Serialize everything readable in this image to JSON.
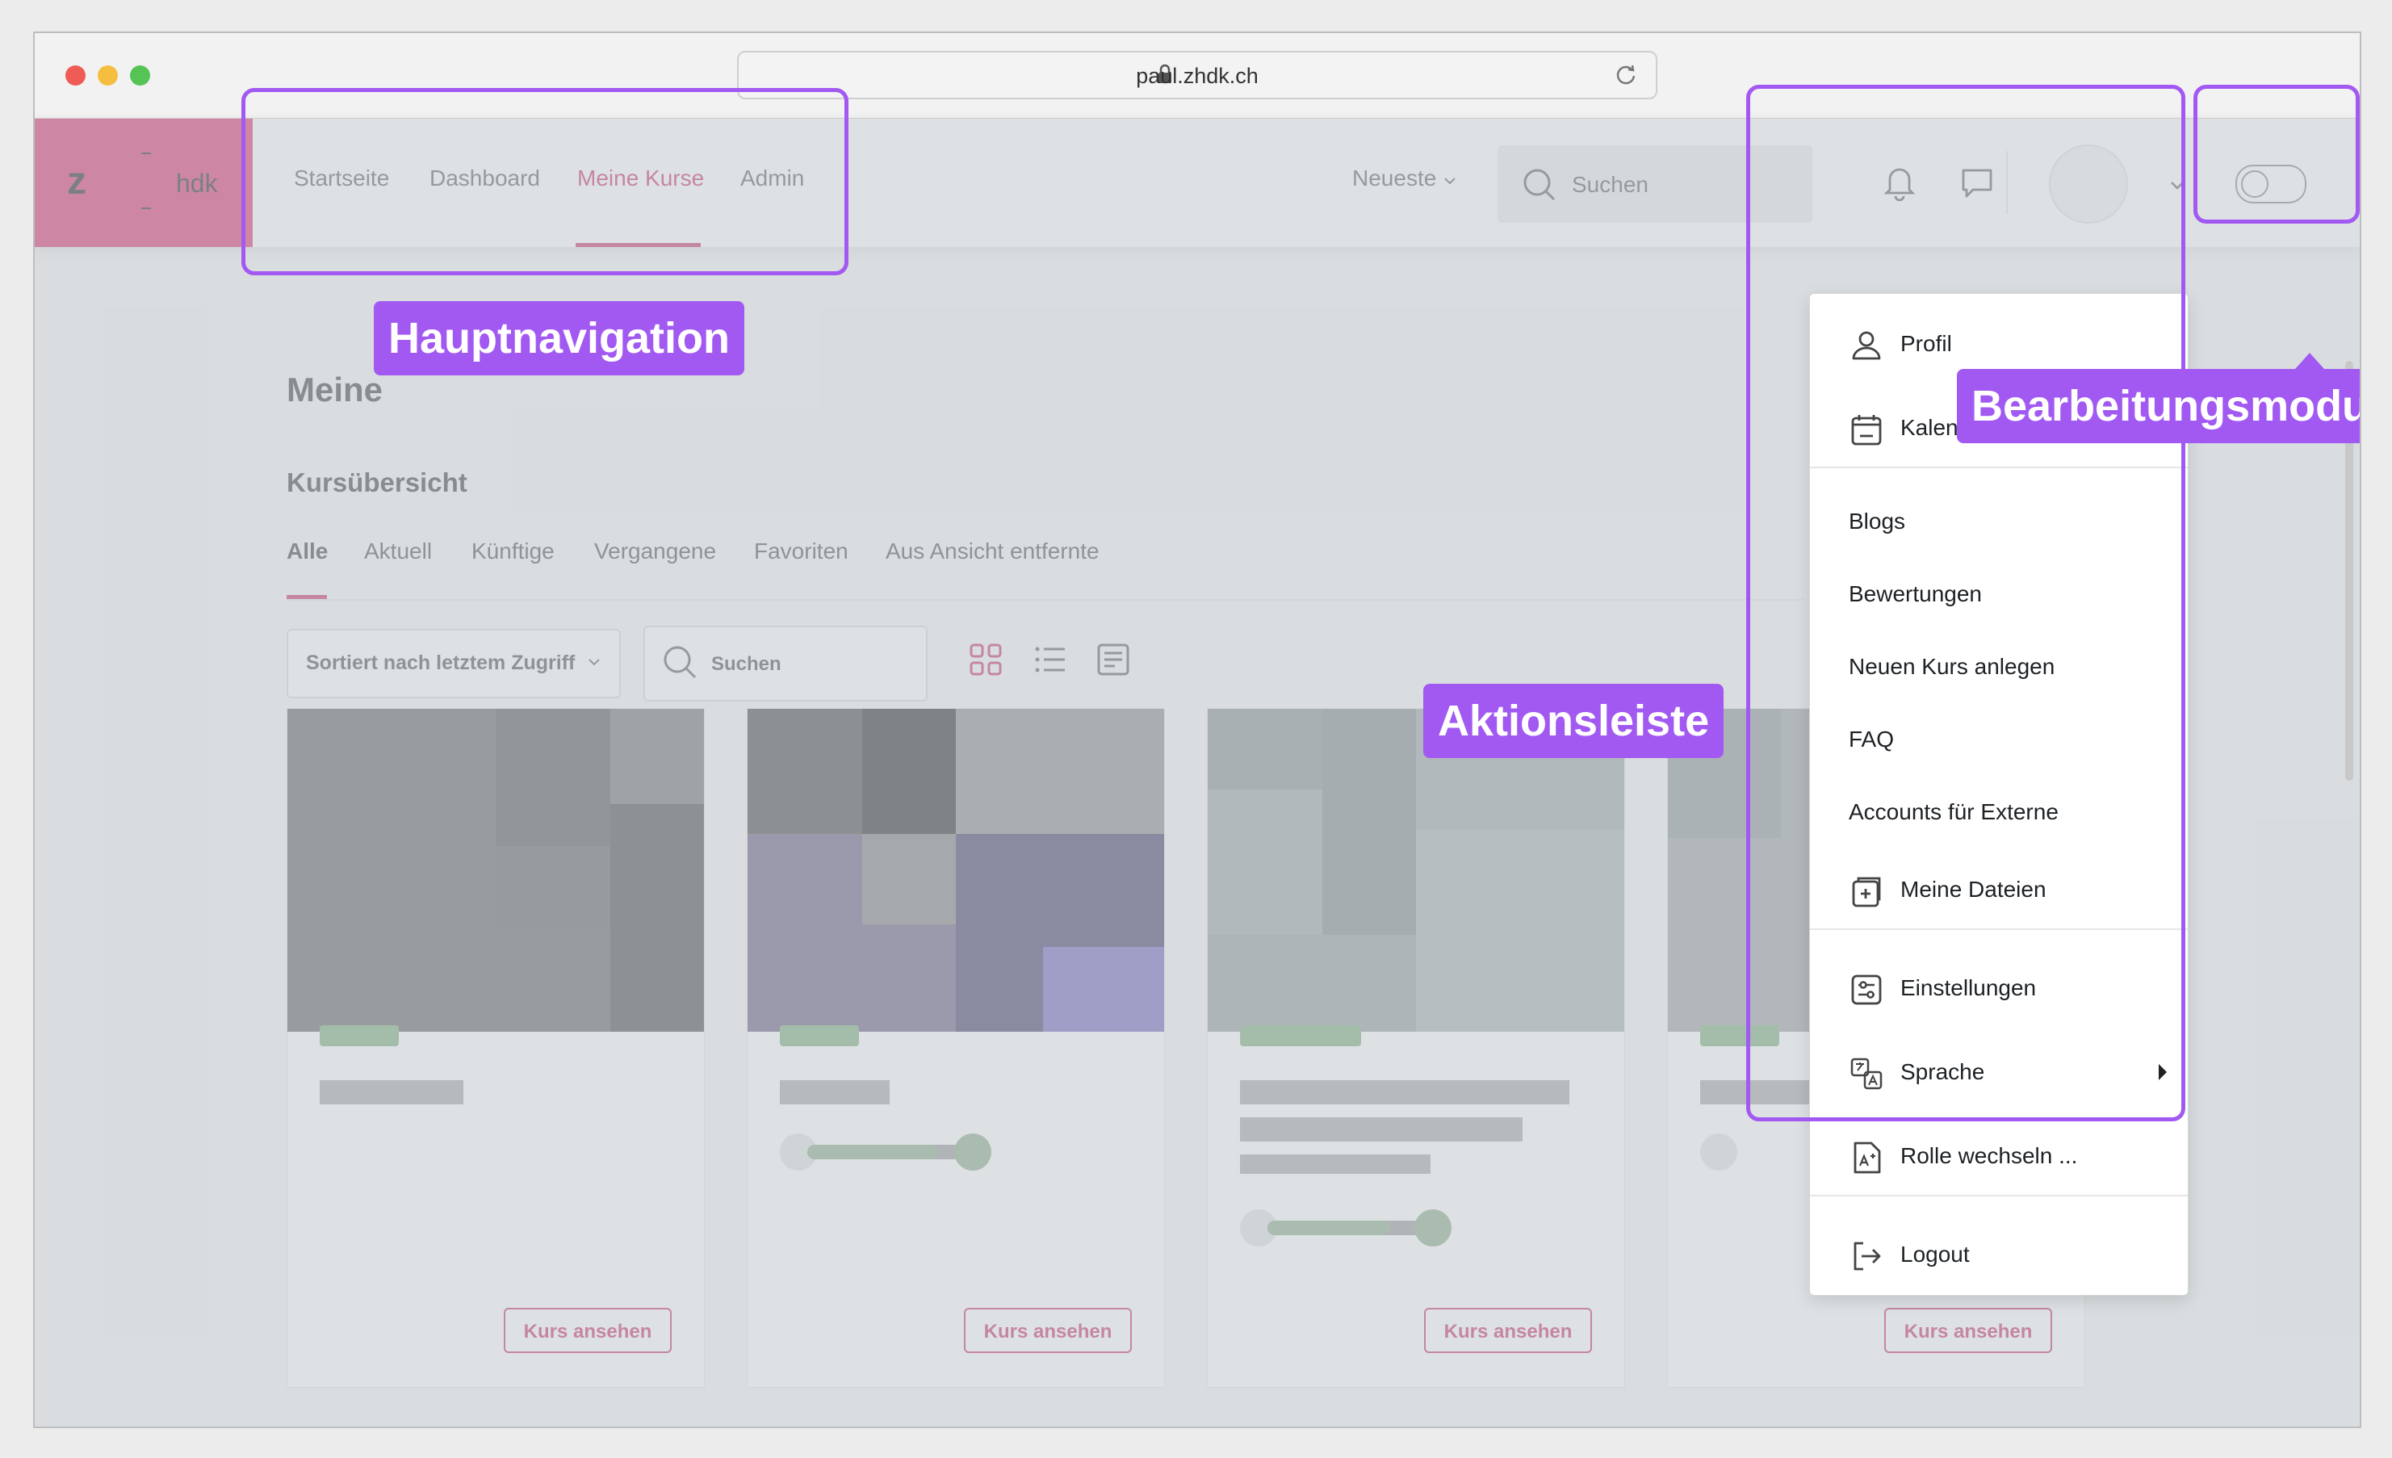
{
  "browser": {
    "url": "paul.zhdk.ch"
  },
  "brand": {
    "logo_letter": "z",
    "logo_text": "hdk"
  },
  "nav": {
    "links": [
      "Startseite",
      "Dashboard",
      "Meine Kurse",
      "Admin"
    ],
    "active": "Meine Kurse",
    "sort_label": "Neueste",
    "search_label": "Suchen"
  },
  "page": {
    "title": "Meine",
    "section_title": "Kursübersicht",
    "tabs": [
      "Alle",
      "Aktuell",
      "Künftige",
      "Vergangene",
      "Favoriten",
      "Aus Ansicht entfernte"
    ],
    "active_tab": "Alle",
    "sort_select": "Sortiert nach letztem Zugriff",
    "search_placeholder": "Suchen"
  },
  "cards": [
    {
      "button": "Kurs ansehen"
    },
    {
      "button": "Kurs ansehen",
      "progress": 0.85
    },
    {
      "button": "Kurs ansehen",
      "progress": 0.8
    },
    {
      "button": "Kurs ansehen"
    }
  ],
  "user_menu": {
    "items": [
      {
        "label": "Profil",
        "icon": "user-icon"
      },
      {
        "label": "Kalender",
        "icon": "calendar-icon"
      },
      {
        "label": "Blogs"
      },
      {
        "label": "Bewertungen"
      },
      {
        "label": "Neuen Kurs anlegen"
      },
      {
        "label": "FAQ"
      },
      {
        "label": "Accounts für Externe"
      },
      {
        "label": "Meine Dateien",
        "icon": "files-icon"
      },
      {
        "label": "Einstellungen",
        "icon": "settings-icon"
      },
      {
        "label": "Sprache",
        "icon": "language-icon"
      },
      {
        "label": "Rolle wechseln ...",
        "icon": "switch-role-icon"
      },
      {
        "label": "Logout",
        "icon": "logout-icon"
      }
    ]
  },
  "annotations": {
    "main_nav": "Hauptnavigation",
    "action_bar": "Aktionsleiste",
    "edit_mode": "Bearbeitungsmodus"
  },
  "colors": {
    "brand": "#d4145a",
    "accent": "#c0114f",
    "highlight": "#a259f2"
  }
}
